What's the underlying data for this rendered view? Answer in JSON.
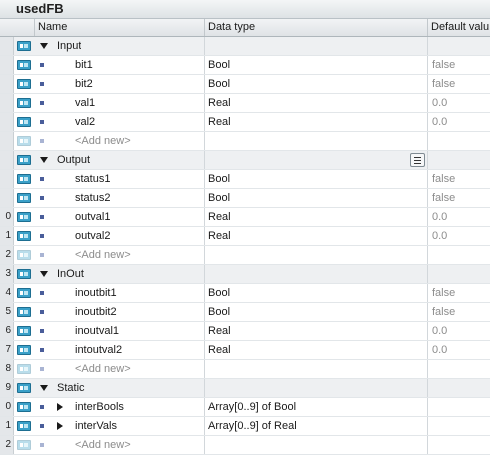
{
  "title": "usedFB",
  "columns": {
    "name": "Name",
    "data_type": "Data type",
    "default_value": "Default valu"
  },
  "sections": [
    {
      "row_number": "",
      "name": "Input",
      "members": [
        {
          "row_number": "",
          "name": "bit1",
          "data_type": "Bool",
          "default_value": "false"
        },
        {
          "row_number": "",
          "name": "bit2",
          "data_type": "Bool",
          "default_value": "false"
        },
        {
          "row_number": "",
          "name": "val1",
          "data_type": "Real",
          "default_value": "0.0"
        },
        {
          "row_number": "",
          "name": "val2",
          "data_type": "Real",
          "default_value": "0.0"
        },
        {
          "row_number": "",
          "name": "<Add new>",
          "placeholder": true
        }
      ]
    },
    {
      "row_number": "",
      "name": "Output",
      "members": [
        {
          "row_number": "",
          "name": "status1",
          "data_type": "Bool",
          "default_value": "false"
        },
        {
          "row_number": "",
          "name": "status2",
          "data_type": "Bool",
          "default_value": "false"
        },
        {
          "row_number": "0",
          "name": "outval1",
          "data_type": "Real",
          "default_value": "0.0"
        },
        {
          "row_number": "1",
          "name": "outval2",
          "data_type": "Real",
          "default_value": "0.0"
        },
        {
          "row_number": "2",
          "name": "<Add new>",
          "placeholder": true
        }
      ]
    },
    {
      "row_number": "3",
      "name": "InOut",
      "members": [
        {
          "row_number": "4",
          "name": "inoutbit1",
          "data_type": "Bool",
          "default_value": "false"
        },
        {
          "row_number": "5",
          "name": "inoutbit2",
          "data_type": "Bool",
          "default_value": "false"
        },
        {
          "row_number": "6",
          "name": "inoutval1",
          "data_type": "Real",
          "default_value": "0.0"
        },
        {
          "row_number": "7",
          "name": "intoutval2",
          "data_type": "Real",
          "default_value": "0.0"
        },
        {
          "row_number": "8",
          "name": "<Add new>",
          "placeholder": true
        }
      ]
    },
    {
      "row_number": "9",
      "name": "Static",
      "members": [
        {
          "row_number": "0",
          "name": "interBools",
          "data_type": "Array[0..9] of Bool",
          "default_value": "",
          "expandable": true
        },
        {
          "row_number": "1",
          "name": "interVals",
          "data_type": "Array[0..9] of Real",
          "default_value": "",
          "expandable": true
        },
        {
          "row_number": "2",
          "name": "<Add new>",
          "placeholder": true
        }
      ]
    }
  ],
  "icons": {
    "interface_member": "interface-member-icon",
    "expand": "expand-triangle-icon",
    "collapse": "collapse-triangle-icon",
    "bullet": "member-bullet-icon",
    "dropdown": "dropdown-list-icon"
  },
  "colors": {
    "icon_accent": "#3aa0c8",
    "section_background": "#eef0f2",
    "default_value_text": "#8c8c8c"
  }
}
